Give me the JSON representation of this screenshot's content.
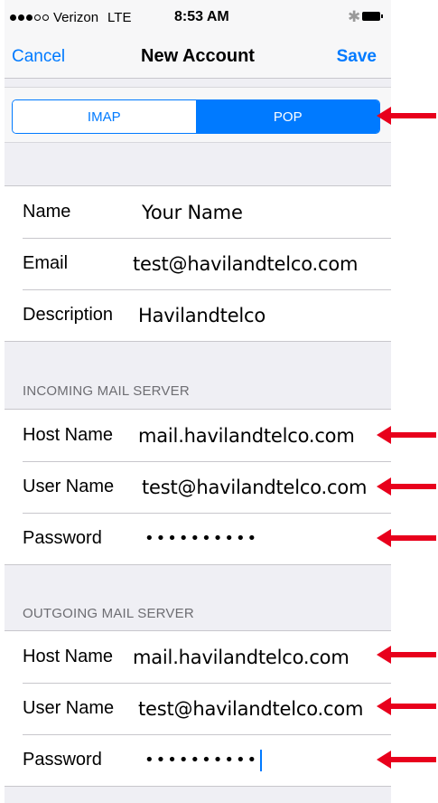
{
  "status_bar": {
    "carrier": "Verizon",
    "network": "LTE",
    "time": "8:53 AM",
    "signal_dots_filled": 3,
    "signal_dots_total": 5
  },
  "nav": {
    "cancel_label": "Cancel",
    "title": "New Account",
    "save_label": "Save"
  },
  "segmented": {
    "options": [
      "IMAP",
      "POP"
    ],
    "selected": "POP"
  },
  "account": {
    "name_label": "Name",
    "name_value": "Your Name",
    "email_label": "Email",
    "email_value": "test@havilandtelco.com",
    "description_label": "Description",
    "description_value": "Havilandtelco"
  },
  "incoming": {
    "header": "INCOMING MAIL SERVER",
    "host_label": "Host Name",
    "host_value": "mail.havilandtelco.com",
    "user_label": "User Name",
    "user_value": "test@havilandtelco.com",
    "password_label": "Password",
    "password_value": "••••••••••"
  },
  "outgoing": {
    "header": "OUTGOING MAIL SERVER",
    "host_label": "Host Name",
    "host_value": "mail.havilandtelco.com",
    "user_label": "User Name",
    "user_value": "test@havilandtelco.com",
    "password_label": "Password",
    "password_value": "••••••••••"
  },
  "colors": {
    "accent": "#007aff",
    "arrow": "#e8001c",
    "background": "#efeff4"
  }
}
